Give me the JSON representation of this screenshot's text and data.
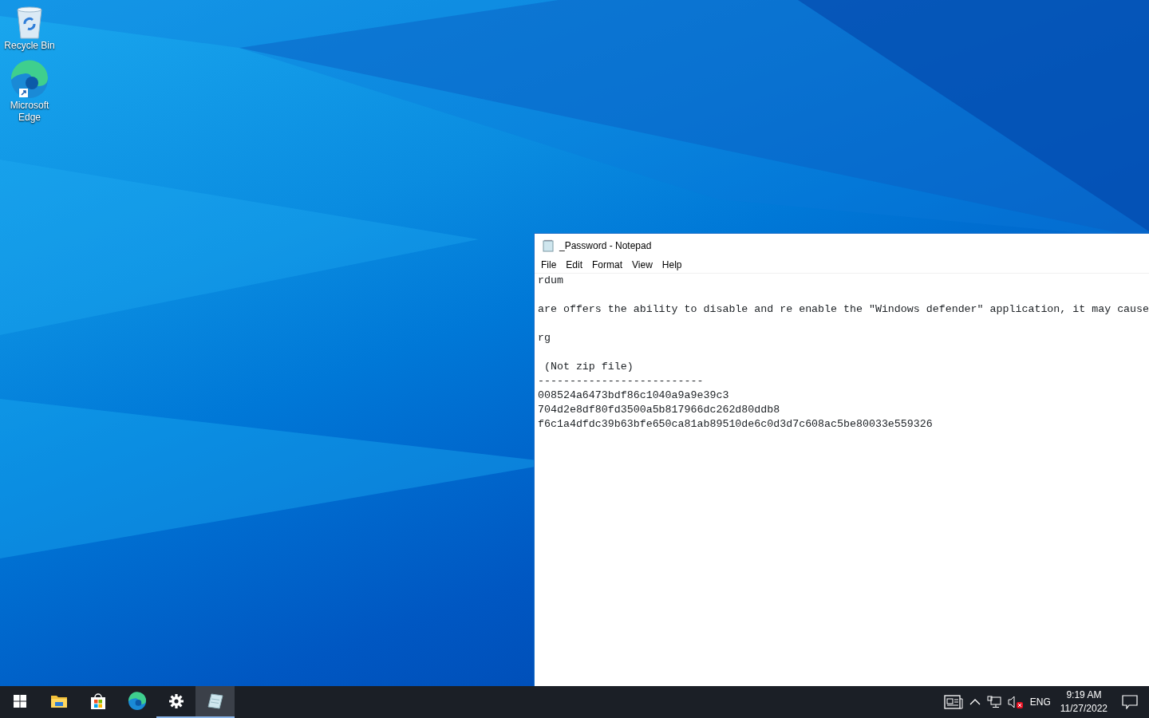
{
  "desktop_icons": [
    {
      "kind": "recycle-bin",
      "label": "Recycle Bin"
    },
    {
      "kind": "edge",
      "label": "Microsoft Edge"
    }
  ],
  "window": {
    "title": "_Password - Notepad",
    "menu": [
      {
        "label": "File"
      },
      {
        "label": "Edit"
      },
      {
        "label": "Format"
      },
      {
        "label": "View"
      },
      {
        "label": "Help"
      }
    ],
    "paragraphs": [
      [
        "rdum"
      ],
      [
        "are offers the ability to disable and re enable the \"Windows defender\" application, it may cause"
      ],
      [
        "rg"
      ],
      [
        " (Not zip file)",
        "--------------------------",
        "008524a6473bdf86c1040a9a9e39c3",
        "704d2e8df80fd3500a5b817966dc262d80ddb8",
        "f6c1a4dfdc39b63bfe650ca81ab89510de6c0d3d7c608ac5be80033e559326"
      ]
    ]
  },
  "taskbar": {
    "apps": [
      {
        "kind": "start",
        "running": false,
        "selected": false
      },
      {
        "kind": "explorer",
        "running": false,
        "selected": false
      },
      {
        "kind": "store",
        "running": false,
        "selected": false
      },
      {
        "kind": "edge",
        "running": false,
        "selected": false
      },
      {
        "kind": "settings",
        "running": true,
        "selected": false
      },
      {
        "kind": "notepad",
        "running": true,
        "selected": true
      }
    ],
    "tray": {
      "language": "ENG",
      "time": "9:19 AM",
      "date": "11/27/2022",
      "muted": true
    }
  }
}
